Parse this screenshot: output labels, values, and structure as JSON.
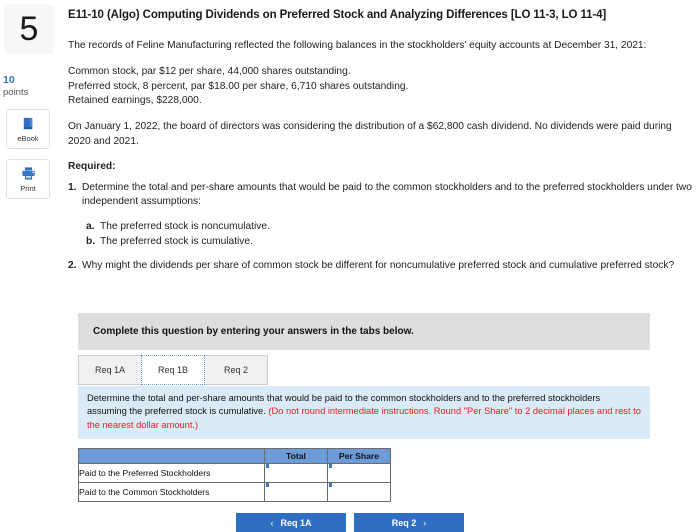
{
  "question": {
    "number": "5",
    "points_value": "10",
    "points_label": "points"
  },
  "rail": {
    "ebook_label": "eBook",
    "print_label": "Print"
  },
  "header": {
    "title": "E11-10 (Algo) Computing Dividends on Preferred Stock and Analyzing Differences [LO 11-3, LO 11-4]"
  },
  "body": {
    "intro": "The records of Feline Manufacturing reflected the following balances in the stockholders' equity accounts at December 31, 2021:",
    "balance_lines": [
      "Common stock, par $12 per share, 44,000 shares outstanding.",
      "Preferred stock, 8 percent, par $18.00 per share, 6,710 shares outstanding.",
      "Retained earnings, $228,000."
    ],
    "scenario": "On January 1, 2022, the board of directors was considering the distribution of a $62,800 cash dividend. No dividends were paid during 2020 and 2021.",
    "required_label": "Required:",
    "requirements": [
      {
        "marker": "1.",
        "text": "Determine the total and per-share amounts that would be paid to the common stockholders and to the preferred stockholders under two independent assumptions:",
        "sub": [
          {
            "marker": "a.",
            "text": "The preferred stock is noncumulative."
          },
          {
            "marker": "b.",
            "text": "The preferred stock is cumulative."
          }
        ]
      },
      {
        "marker": "2.",
        "text": "Why might the dividends per share of common stock be different for noncumulative preferred stock and cumulative preferred stock?"
      }
    ]
  },
  "widget": {
    "banner": "Complete this question by entering your answers in the tabs below.",
    "tabs": [
      {
        "label": "Req 1A",
        "active": false
      },
      {
        "label": "Req 1B",
        "active": true
      },
      {
        "label": "Req 2",
        "active": false
      }
    ],
    "instruction_main": "Determine the total and per-share amounts that would be paid to the common stockholders and to the preferred stockholders assuming the preferred stock is cumulative.",
    "instruction_hint": "(Do not round intermediate instructions. Round \"Per Share\" to 2 decimal places and rest to the nearest dollar amount.)",
    "table": {
      "headers": [
        "",
        "Total",
        "Per Share"
      ],
      "rows": [
        {
          "label": "Paid to the Preferred Stockholders",
          "total": "",
          "per_share": ""
        },
        {
          "label": "Paid to the Common Stockholders",
          "total": "",
          "per_share": ""
        }
      ]
    },
    "nav": {
      "prev_label": "Req 1A",
      "prev_chevron": "‹",
      "next_label": "Req 2",
      "next_chevron": "›"
    }
  },
  "colors": {
    "accent_blue": "#2f6fc0",
    "table_header_blue": "#6c9bd8",
    "instruction_bg": "#dbeaf7",
    "banner_grey": "#dedede",
    "hint_red": "#e02020"
  }
}
